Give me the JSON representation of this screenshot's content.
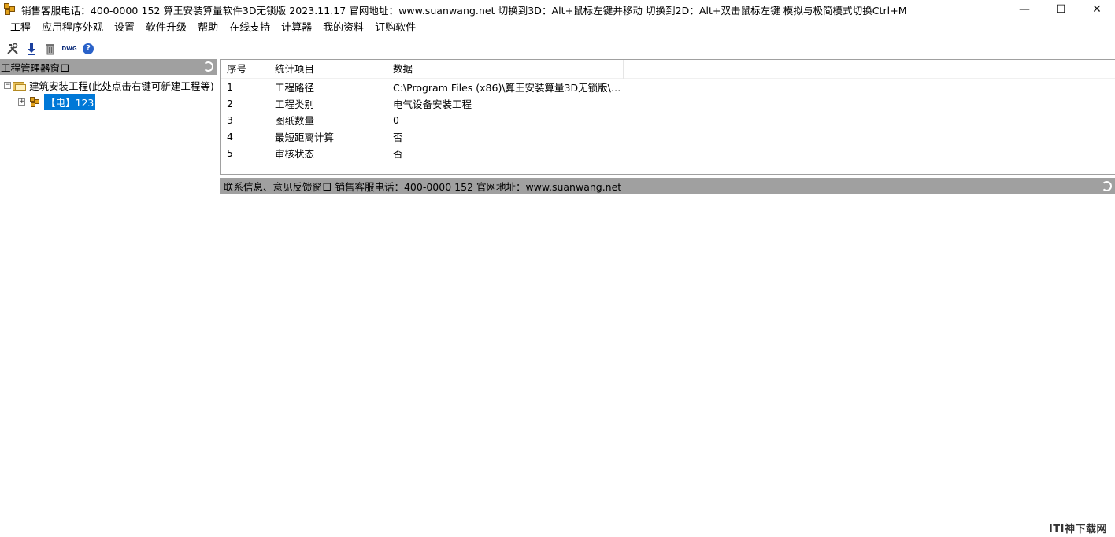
{
  "window": {
    "title": "销售客服电话：400-0000 152   算王安装算量软件3D无锁版 2023.11.17 官网地址：www.suanwang.net   切换到3D：Alt+鼠标左键并移动 切换到2D：Alt+双击鼠标左键 模拟与极简模式切换Ctrl+M",
    "minimize": "—",
    "maximize": "☐",
    "close": "✕"
  },
  "menu": [
    "工程",
    "应用程序外观",
    "设置",
    "软件升级",
    "帮助",
    "在线支持",
    "计算器",
    "我的资料",
    "订购软件"
  ],
  "toolbar": {
    "tools_icon": "tools-icon",
    "download_icon": "download-icon",
    "trash_icon": "trash-icon",
    "dwg_label": "DWG",
    "help_icon": "help-icon"
  },
  "left_pane": {
    "title": "工程管理器窗口",
    "tree": {
      "root_label": "建筑安装工程(此处点击右键可新建工程等)",
      "child_label": "【电】123"
    }
  },
  "table": {
    "headers": [
      "序号",
      "统计项目",
      "数据"
    ],
    "rows": [
      [
        "1",
        "工程路径",
        "C:\\Program Files (x86)\\算王安装算量3D无锁版\\工..."
      ],
      [
        "2",
        "工程类别",
        "电气设备安装工程"
      ],
      [
        "3",
        "图纸数量",
        "0"
      ],
      [
        "4",
        "最短距离计算",
        "否"
      ],
      [
        "5",
        "审核状态",
        "否"
      ]
    ]
  },
  "info_bar": {
    "text": "联系信息、意见反馈窗口  销售客服电话：400-0000 152   官网地址：www.suanwang.net"
  },
  "watermark": "ITI神下载网",
  "colors": {
    "header_gray": "#a0a0a0",
    "selection_blue": "#0078d7",
    "app_icon_gold": "#e2a21c"
  }
}
